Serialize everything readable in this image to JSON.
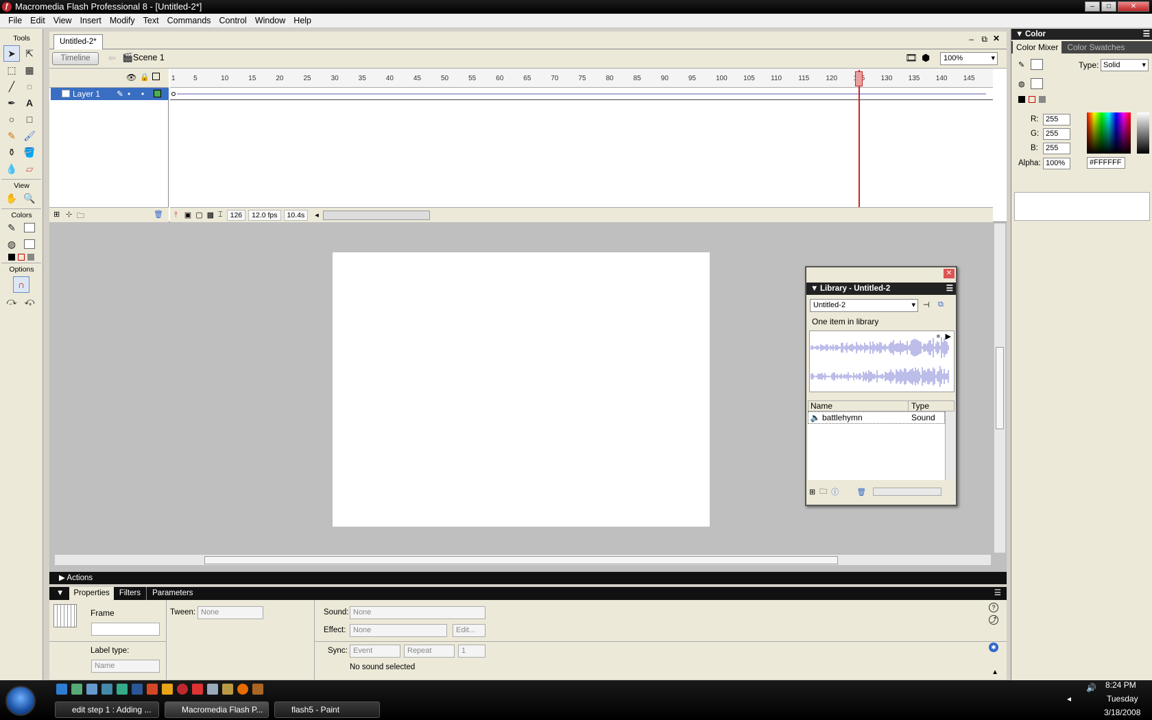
{
  "window": {
    "title": "Macromedia Flash Professional 8 - [Untitled-2*]"
  },
  "menu": [
    "File",
    "Edit",
    "View",
    "Insert",
    "Modify",
    "Text",
    "Commands",
    "Control",
    "Window",
    "Help"
  ],
  "tools": {
    "header": "Tools",
    "view": "View",
    "colors": "Colors",
    "options": "Options"
  },
  "document": {
    "tab": "Untitled-2*",
    "timeline_button": "Timeline",
    "scene": "Scene 1",
    "zoom": "100%"
  },
  "timeline": {
    "layer_name": "Layer 1",
    "ticks": [
      "1",
      "5",
      "10",
      "15",
      "20",
      "25",
      "30",
      "35",
      "40",
      "45",
      "50",
      "55",
      "60",
      "65",
      "70",
      "75",
      "80",
      "85",
      "90",
      "95",
      "100",
      "105",
      "110",
      "115",
      "120",
      "125",
      "130",
      "135",
      "140",
      "145"
    ],
    "current_frame": "126",
    "fps": "12.0 fps",
    "time": "10.4s"
  },
  "library": {
    "title": "Library - Untitled-2",
    "doc": "Untitled-2",
    "count": "One item in library",
    "col_name": "Name",
    "col_type": "Type",
    "item_name": "battlehymn",
    "item_type": "Sound"
  },
  "color_panel": {
    "title": "Color",
    "tab_mixer": "Color Mixer",
    "tab_swatches": "Color Swatches",
    "type_label": "Type:",
    "type_value": "Solid",
    "r_label": "R:",
    "r": "255",
    "g_label": "G:",
    "g": "255",
    "b_label": "B:",
    "b": "255",
    "alpha_label": "Alpha:",
    "alpha": "100%",
    "hex": "#FFFFFF"
  },
  "panels": {
    "actions": "Actions",
    "tab_properties": "Properties",
    "tab_filters": "Filters",
    "tab_parameters": "Parameters",
    "frame_label": "Frame",
    "tween_label": "Tween:",
    "tween_value": "None",
    "sound_label": "Sound:",
    "sound_value": "None",
    "effect_label": "Effect:",
    "effect_value": "None",
    "edit_button": "Edit...",
    "sync_label": "Sync:",
    "sync_value": "Event",
    "repeat_value": "Repeat",
    "repeat_count": "1",
    "no_sound": "No sound selected",
    "label_type": "Label type:",
    "label_type_value": "Name"
  },
  "taskbar": {
    "tasks": [
      "edit step 1 : Adding ...",
      "Macromedia Flash P...",
      "flash5 - Paint"
    ],
    "time": "8:24 PM",
    "day": "Tuesday",
    "date": "3/18/2008"
  },
  "colors": {
    "accent": "#3a6ec2",
    "playhead": "#cc2222",
    "waveform": "#7b7bd6"
  }
}
